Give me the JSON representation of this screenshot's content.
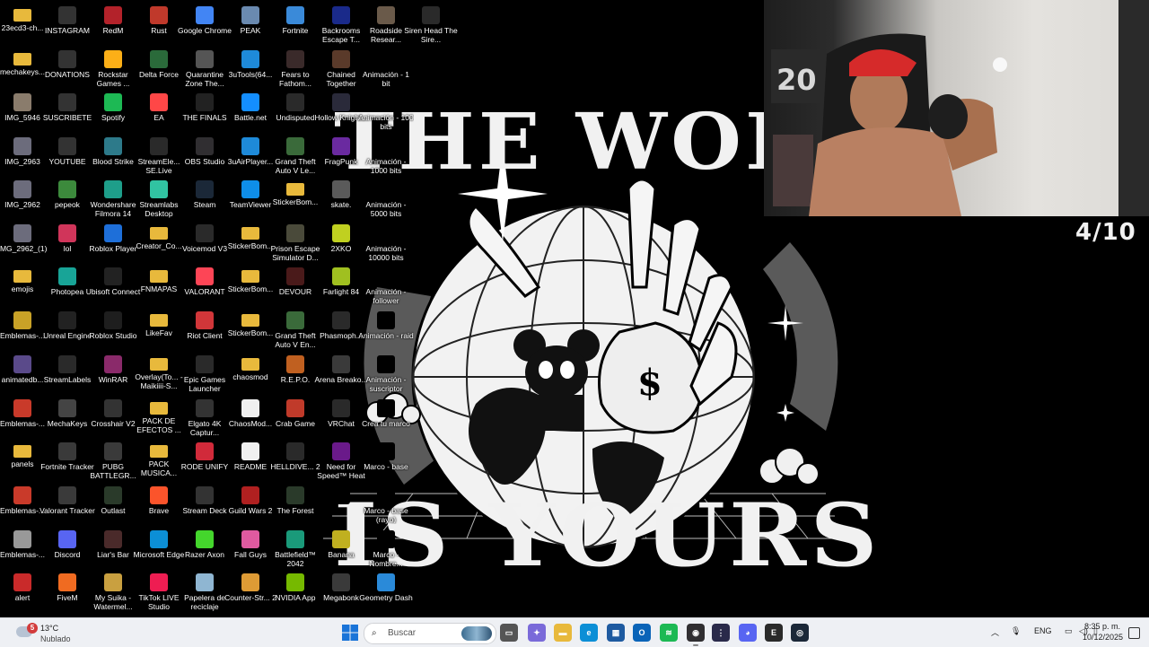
{
  "desktop": {
    "icons": [
      {
        "label": "23ecd3-ch...",
        "icon": "folder-icon",
        "color": "#e8b93c"
      },
      {
        "label": "mechakeys...",
        "icon": "folder-icon",
        "color": "#e8b93c"
      },
      {
        "label": "IMG_5946",
        "icon": "image-icon",
        "color": "#8a7c6c"
      },
      {
        "label": "IMG_2963",
        "icon": "image-icon",
        "color": "#6c6c7c"
      },
      {
        "label": "IMG_2962",
        "icon": "image-icon",
        "color": "#6c6c7c"
      },
      {
        "label": "IMG_2962_(1)",
        "icon": "image-icon",
        "color": "#6c6c7c"
      },
      {
        "label": "emojis",
        "icon": "folder-icon",
        "color": "#e8b93c"
      },
      {
        "label": "Emblemas-...",
        "icon": "emblem-icon",
        "color": "#c9a227"
      },
      {
        "label": "animatedb...",
        "icon": "image-icon",
        "color": "#5a4a8a"
      },
      {
        "label": "Emblemas-...",
        "icon": "emblem-icon",
        "color": "#c93a2a"
      },
      {
        "label": "panels",
        "icon": "folder-icon",
        "color": "#e8b93c"
      },
      {
        "label": "Emblemas-...",
        "icon": "emblem-icon",
        "color": "#c93a2a"
      },
      {
        "label": "Emblemas-...",
        "icon": "emblem-icon",
        "color": "#999999"
      },
      {
        "label": "alert",
        "icon": "alert-icon",
        "color": "#c92a2a"
      },
      {
        "label": "INSTAGRAM",
        "icon": "dash-icon",
        "color": "#333333"
      },
      {
        "label": "DONATIONS",
        "icon": "dash-icon",
        "color": "#333333"
      },
      {
        "label": "SUSCRIBETE",
        "icon": "dash-icon",
        "color": "#333333"
      },
      {
        "label": "YOUTUBE",
        "icon": "dash-icon",
        "color": "#333333"
      },
      {
        "label": "pepeok",
        "icon": "frog-icon",
        "color": "#3c8a3c"
      },
      {
        "label": "lol",
        "icon": "heart-icon",
        "color": "#d0355a"
      },
      {
        "label": "Photopea",
        "icon": "photopea-icon",
        "color": "#18a497"
      },
      {
        "label": "Unreal Engine",
        "icon": "unreal-icon",
        "color": "#222222"
      },
      {
        "label": "StreamLabels",
        "icon": "streamlabels-icon",
        "color": "#2a2a2a"
      },
      {
        "label": "MechaKeys",
        "icon": "keyboard-icon",
        "color": "#444444"
      },
      {
        "label": "Fortnite Tracker",
        "icon": "tracker-icon",
        "color": "#3a3a3a"
      },
      {
        "label": "Valorant Tracker",
        "icon": "valorant-icon",
        "color": "#3a3a3a"
      },
      {
        "label": "Discord",
        "icon": "discord-icon",
        "color": "#5865f2"
      },
      {
        "label": "FiveM",
        "icon": "fivem-icon",
        "color": "#f06b21"
      },
      {
        "label": "RedM",
        "icon": "redm-icon",
        "color": "#b3222a"
      },
      {
        "label": "Rockstar Games ...",
        "icon": "rockstar-icon",
        "color": "#fcaf17"
      },
      {
        "label": "Spotify",
        "icon": "spotify-icon",
        "color": "#1db954"
      },
      {
        "label": "Blood Strike",
        "icon": "bloodstrike-icon",
        "color": "#2d7a8a"
      },
      {
        "label": "Wondershare Filmora 14",
        "icon": "filmora-icon",
        "color": "#1e9e8a"
      },
      {
        "label": "Roblox Player",
        "icon": "roblox-icon",
        "color": "#1e6fd9"
      },
      {
        "label": "Ubisoft Connect",
        "icon": "ubisoft-icon",
        "color": "#222222"
      },
      {
        "label": "Roblox Studio",
        "icon": "roblox-studio-icon",
        "color": "#1e1e1e"
      },
      {
        "label": "WinRAR",
        "icon": "winrar-icon",
        "color": "#8a2a6a"
      },
      {
        "label": "Crosshair V2",
        "icon": "crosshair-icon",
        "color": "#333333"
      },
      {
        "label": "PUBG BATTLEGR...",
        "icon": "pubg-icon",
        "color": "#3a3a3a"
      },
      {
        "label": "Outlast",
        "icon": "outlast-icon",
        "color": "#2a3a2a"
      },
      {
        "label": "Liar's Bar",
        "icon": "liarsbar-icon",
        "color": "#4a2a2a"
      },
      {
        "label": "My Suika - Watermel...",
        "icon": "suika-icon",
        "color": "#c9a040"
      },
      {
        "label": "Rust",
        "icon": "rust-icon",
        "color": "#c0392b"
      },
      {
        "label": "Delta Force",
        "icon": "deltaforce-icon",
        "color": "#2a6a3a"
      },
      {
        "label": "EA",
        "icon": "ea-icon",
        "color": "#ff4747"
      },
      {
        "label": "StreamEle... SE.Live",
        "icon": "streamelements-icon",
        "color": "#2a2a2a"
      },
      {
        "label": "Streamlabs Desktop",
        "icon": "streamlabs-icon",
        "color": "#31c3a2"
      },
      {
        "label": "Creator_Co...",
        "icon": "folder-icon",
        "color": "#e8b93c"
      },
      {
        "label": "FNMAPAS",
        "icon": "folder-icon",
        "color": "#e8b93c"
      },
      {
        "label": "LikeFav",
        "icon": "folder-icon",
        "color": "#e8b93c"
      },
      {
        "label": "Overlay(To... - Maikiiii-S...",
        "icon": "folder-icon",
        "color": "#e8b93c"
      },
      {
        "label": "PACK DE EFECTOS ...",
        "icon": "folder-icon",
        "color": "#e8b93c"
      },
      {
        "label": "PACK MUSICA...",
        "icon": "folder-icon",
        "color": "#e8b93c"
      },
      {
        "label": "Brave",
        "icon": "brave-icon",
        "color": "#fb542b"
      },
      {
        "label": "Microsoft Edge",
        "icon": "edge-icon",
        "color": "#0c8fd6"
      },
      {
        "label": "TikTok LIVE Studio",
        "icon": "tiktok-icon",
        "color": "#ee1d52"
      },
      {
        "label": "Google Chrome",
        "icon": "chrome-icon",
        "color": "#4285f4"
      },
      {
        "label": "Quarantine Zone The...",
        "icon": "game-icon",
        "color": "#555555"
      },
      {
        "label": "THE FINALS",
        "icon": "thefinals-icon",
        "color": "#222222"
      },
      {
        "label": "OBS Studio",
        "icon": "obs-icon",
        "color": "#302e31"
      },
      {
        "label": "Steam",
        "icon": "steam-icon",
        "color": "#1b2838"
      },
      {
        "label": "Voicemod V3",
        "icon": "voicemod-icon",
        "color": "#2a2a2a"
      },
      {
        "label": "VALORANT",
        "icon": "valorant-icon",
        "color": "#fd4556"
      },
      {
        "label": "Riot Client",
        "icon": "riot-icon",
        "color": "#d13639"
      },
      {
        "label": "Epic Games Launcher",
        "icon": "epic-icon",
        "color": "#2a2a2a"
      },
      {
        "label": "Elgato 4K Captur...",
        "icon": "elgato-icon",
        "color": "#333333"
      },
      {
        "label": "RODE UNIFY",
        "icon": "rode-icon",
        "color": "#d12a3a"
      },
      {
        "label": "Stream Deck",
        "icon": "streamdeck-icon",
        "color": "#333333"
      },
      {
        "label": "Razer Axon",
        "icon": "razer-icon",
        "color": "#44d62c"
      },
      {
        "label": "Papelera de reciclaje",
        "icon": "recycle-bin-icon",
        "color": "#8fb6d2"
      },
      {
        "label": "PEAK",
        "icon": "peak-icon",
        "color": "#6a8ab0"
      },
      {
        "label": "3uTools(64...",
        "icon": "3utools-icon",
        "color": "#1e8ad9"
      },
      {
        "label": "Battle.net",
        "icon": "battlenet-icon",
        "color": "#148eff"
      },
      {
        "label": "3uAirPlayer...",
        "icon": "3uairplayer-icon",
        "color": "#1e8ad9"
      },
      {
        "label": "TeamViewer",
        "icon": "teamviewer-icon",
        "color": "#0e8ee9"
      },
      {
        "label": "StickerBom...",
        "icon": "folder-icon",
        "color": "#e8b93c"
      },
      {
        "label": "StickerBom...",
        "icon": "folder-icon",
        "color": "#e8b93c"
      },
      {
        "label": "StickerBom...",
        "icon": "folder-icon",
        "color": "#e8b93c"
      },
      {
        "label": "chaosmod",
        "icon": "folder-icon",
        "color": "#e8b93c"
      },
      {
        "label": "ChaosMod...",
        "icon": "file-icon",
        "color": "#f0f0f0"
      },
      {
        "label": "README",
        "icon": "file-icon",
        "color": "#f0f0f0"
      },
      {
        "label": "Guild Wars 2",
        "icon": "guildwars-icon",
        "color": "#b02020"
      },
      {
        "label": "Fall Guys",
        "icon": "fallguys-icon",
        "color": "#e05aa0"
      },
      {
        "label": "Counter-Str... 2",
        "icon": "cs2-icon",
        "color": "#de9b35"
      },
      {
        "label": "Fortnite",
        "icon": "fortnite-icon",
        "color": "#3a8ad9"
      },
      {
        "label": "Fears to Fathom...",
        "icon": "game-icon",
        "color": "#3a2a2a"
      },
      {
        "label": "Undisputed",
        "icon": "undisputed-icon",
        "color": "#2a2a2a"
      },
      {
        "label": "Grand Theft Auto V Le...",
        "icon": "gta-icon",
        "color": "#3a6a3a"
      },
      {
        "label": "StickerBom...",
        "icon": "folder-icon",
        "color": "#e8b93c"
      },
      {
        "label": "Prison Escape Simulator D...",
        "icon": "game-icon",
        "color": "#4a4a3a"
      },
      {
        "label": "DEVOUR",
        "icon": "devour-icon",
        "color": "#4a1a1a"
      },
      {
        "label": "Grand Theft Auto V En...",
        "icon": "gta-icon",
        "color": "#3a6a3a"
      },
      {
        "label": "R.E.P.O.",
        "icon": "repo-icon",
        "color": "#c06020"
      },
      {
        "label": "Crab Game",
        "icon": "crabgame-icon",
        "color": "#c03a2a"
      },
      {
        "label": "HELLDIVE... 2",
        "icon": "helldivers-icon",
        "color": "#2a2a2a"
      },
      {
        "label": "The Forest",
        "icon": "forest-icon",
        "color": "#2a3a2a"
      },
      {
        "label": "Battlefield™ 2042",
        "icon": "battlefield-icon",
        "color": "#1a9a7a"
      },
      {
        "label": "NVIDIA App",
        "icon": "nvidia-icon",
        "color": "#76b900"
      },
      {
        "label": "Backrooms Escape T...",
        "icon": "game-icon",
        "color": "#1a2a8a"
      },
      {
        "label": "Chained Together",
        "icon": "game-icon",
        "color": "#5a3a2a"
      },
      {
        "label": "Hollow Knight...",
        "icon": "hollowknight-icon",
        "color": "#2a2a3a"
      },
      {
        "label": "FragPunk",
        "icon": "fragpunk-icon",
        "color": "#6a2aa0"
      },
      {
        "label": "skate.",
        "icon": "skate-icon",
        "color": "#5a5a5a"
      },
      {
        "label": "2XKO",
        "icon": "2xko-icon",
        "color": "#c0d020"
      },
      {
        "label": "Farlight 84",
        "icon": "farlight-icon",
        "color": "#a0c020"
      },
      {
        "label": "Phasmoph...",
        "icon": "phasmophobia-icon",
        "color": "#2a2a2a"
      },
      {
        "label": "Arena Breako...",
        "icon": "arena-icon",
        "color": "#3a3a3a"
      },
      {
        "label": "VRChat",
        "icon": "vrchat-icon",
        "color": "#2a2a2a"
      },
      {
        "label": "Need for Speed™ Heat",
        "icon": "nfs-icon",
        "color": "#6a1a8a"
      },
      {
        "label": "",
        "icon": "blank-icon",
        "color": "#000000"
      },
      {
        "label": "Banana",
        "icon": "banana-icon",
        "color": "#c0b020"
      },
      {
        "label": "Megabonk",
        "icon": "megabonk-icon",
        "color": "#3a3a3a"
      },
      {
        "label": "Roadside Resear...",
        "icon": "game-icon",
        "color": "#6a5a4a"
      },
      {
        "label": "Animación - 1 bit",
        "icon": "blank-icon",
        "color": "#000000"
      },
      {
        "label": "Animación - 100 bits",
        "icon": "blank-icon",
        "color": "#000000"
      },
      {
        "label": "Animación - 1000 bits",
        "icon": "blank-icon",
        "color": "#000000"
      },
      {
        "label": "Animación - 5000 bits",
        "icon": "blank-icon",
        "color": "#000000"
      },
      {
        "label": "Animación - 10000 bits",
        "icon": "blank-icon",
        "color": "#000000"
      },
      {
        "label": "Animación - follower",
        "icon": "blank-icon",
        "color": "#000000"
      },
      {
        "label": "Animación - raid",
        "icon": "blank-icon",
        "color": "#000000"
      },
      {
        "label": "Animación - suscriptor",
        "icon": "blank-icon",
        "color": "#000000"
      },
      {
        "label": "Crea tu marco",
        "icon": "blank-icon",
        "color": "#000000"
      },
      {
        "label": "Marco - base",
        "icon": "blank-icon",
        "color": "#000000"
      },
      {
        "label": "Marco - base (rayo)",
        "icon": "blank-icon",
        "color": "#000000"
      },
      {
        "label": "Marco - Nombre...",
        "icon": "blank-icon",
        "color": "#000000"
      },
      {
        "label": "Geometry Dash",
        "icon": "geometrydash-icon",
        "color": "#2a8ad9"
      },
      {
        "label": "Siren Head The Sire...",
        "icon": "game-icon",
        "color": "#2a2a2a"
      }
    ]
  },
  "wallpaper": {
    "title_top": "THE WORLD",
    "title_bottom": "IS YOURS",
    "money_symbol": "$"
  },
  "stream": {
    "counter": "4/10"
  },
  "taskbar": {
    "weather": {
      "temp": "13°C",
      "condition": "Nublado",
      "badge": "5"
    },
    "search_placeholder": "Buscar",
    "apps": [
      {
        "name": "task-view",
        "color": "#555555",
        "glyph": "▭"
      },
      {
        "name": "copilot",
        "color": "#7a6ad9",
        "glyph": "✦"
      },
      {
        "name": "file-explorer",
        "color": "#e8b93c",
        "glyph": "▬"
      },
      {
        "name": "edge",
        "color": "#0c8fd6",
        "glyph": "e"
      },
      {
        "name": "store",
        "color": "#1e5aa0",
        "glyph": "▦"
      },
      {
        "name": "outlook",
        "color": "#0a64b8",
        "glyph": "O"
      },
      {
        "name": "spotify",
        "color": "#1db954",
        "glyph": "≋"
      },
      {
        "name": "obs",
        "color": "#302e31",
        "glyph": "◉"
      },
      {
        "name": "app-dots",
        "color": "#2a2a4a",
        "glyph": "⋮"
      },
      {
        "name": "discord",
        "color": "#5865f2",
        "glyph": "◕"
      },
      {
        "name": "epic-games",
        "color": "#2a2a2a",
        "glyph": "E"
      },
      {
        "name": "steam",
        "color": "#1b2838",
        "glyph": "◎"
      }
    ],
    "language": "ENG",
    "time": "8:35 p. m.",
    "date": "10/12/2025"
  }
}
